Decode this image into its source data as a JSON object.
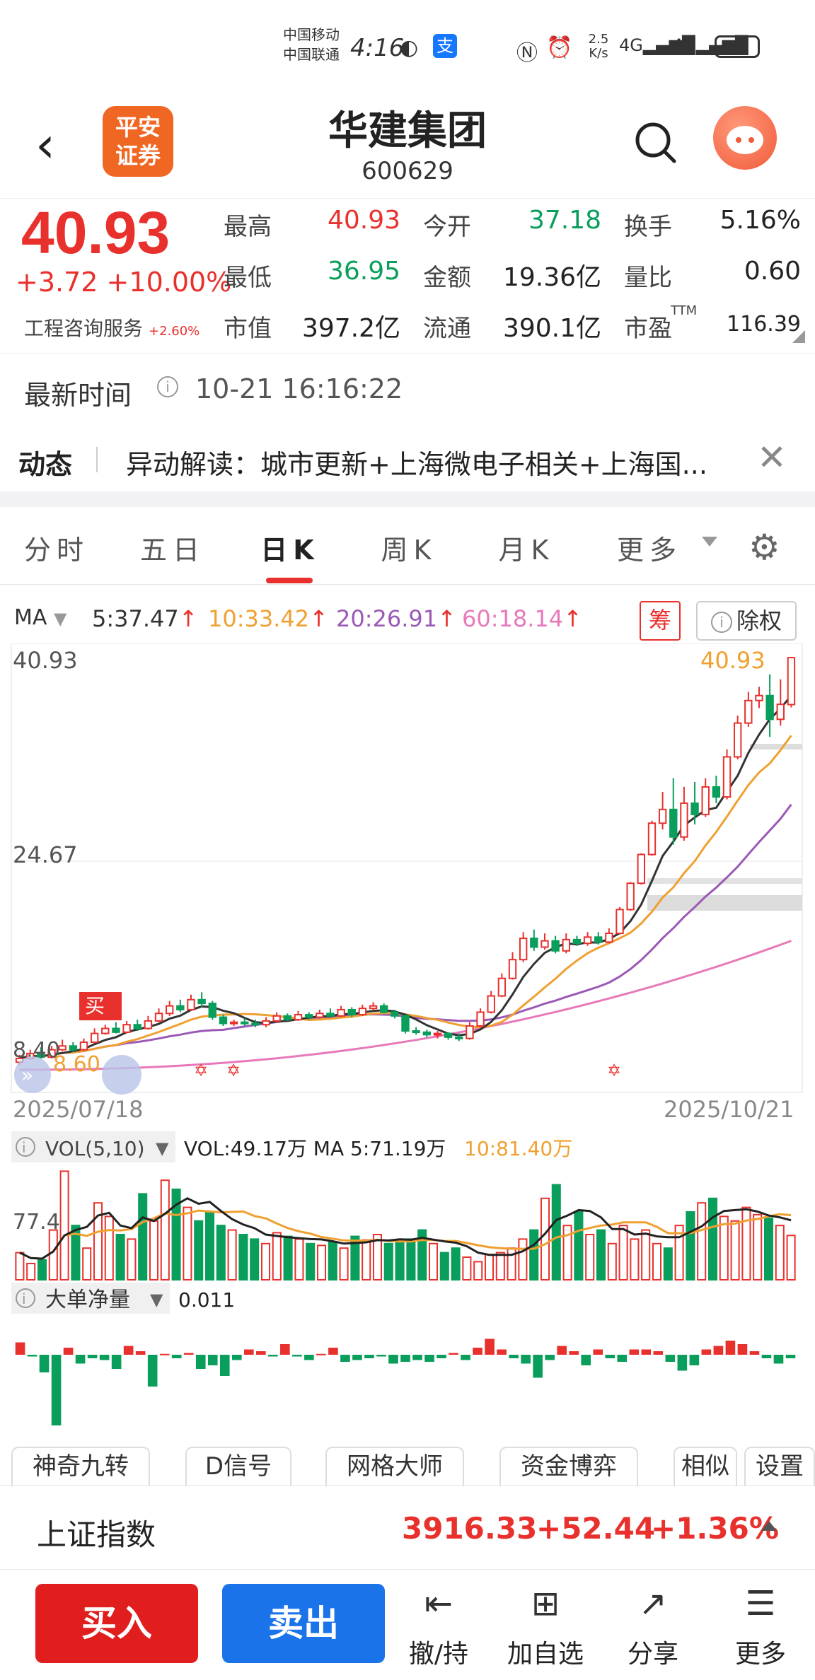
{
  "status_bar": {
    "carrier1": "中国移动",
    "carrier2": "中国联通",
    "time": "4:16",
    "net_speed": "2.5 K/s",
    "battery": "46"
  },
  "header": {
    "logo_line1": "平安",
    "logo_line2": "证券",
    "name": "华建集团",
    "code": "600629"
  },
  "quote": {
    "price": "40.93",
    "change": "+3.72",
    "change_pct": "+10.00%",
    "industry": "工程咨询服务",
    "industry_pct": "+2.60%",
    "high_label": "最高",
    "high": "40.93",
    "open_label": "今开",
    "open": "37.18",
    "turnover_label": "换手",
    "turnover": "5.16%",
    "low_label": "最低",
    "low": "36.95",
    "amount_label": "金额",
    "amount": "19.36亿",
    "vol_ratio_label": "量比",
    "vol_ratio": "0.60",
    "mktcap_label": "市值",
    "mktcap": "397.2亿",
    "float_label": "流通",
    "float": "390.1亿",
    "pe_label": "市盈",
    "pe_sup": "TTM",
    "pe": "116.39"
  },
  "latest": {
    "label": "最新时间",
    "time": "10-21 16:16:22"
  },
  "news": {
    "tag": "动态",
    "text": "异动解读：城市更新+上海微电子相关+上海国..."
  },
  "tabs": [
    "分时",
    "五日",
    "日K",
    "周K",
    "月K",
    "更多"
  ],
  "ma": {
    "label": "MA",
    "ma5": "5:37.47",
    "ma10": "10:33.42",
    "ma20": "20:26.91",
    "ma60": "60:18.14",
    "chou": "筹",
    "chuquan": "除权",
    "colors": {
      "ma5": "#333333",
      "ma10": "#f0a030",
      "ma20": "#9b59b6",
      "ma60": "#e879b9"
    }
  },
  "chart_data": [
    {
      "type": "candlestick",
      "y_labels": [
        "40.93",
        "24.67"
      ],
      "high_annotation": "40.93",
      "low_annotation": "8.60",
      "left_price_label": "8.40",
      "buy_marker": "买",
      "start_date": "2025/07/18",
      "end_date": "2025/10/21",
      "candles": [
        {
          "o": 8.6,
          "c": 8.9,
          "h": 9.2,
          "l": 8.4
        },
        {
          "o": 8.9,
          "c": 9.3,
          "h": 9.6,
          "l": 8.8
        },
        {
          "o": 9.3,
          "c": 9.0,
          "h": 9.8,
          "l": 8.9
        },
        {
          "o": 9.0,
          "c": 9.6,
          "h": 9.9,
          "l": 8.9
        },
        {
          "o": 9.6,
          "c": 9.9,
          "h": 10.4,
          "l": 9.5
        },
        {
          "o": 9.9,
          "c": 9.6,
          "h": 10.2,
          "l": 9.4
        },
        {
          "o": 9.6,
          "c": 10.2,
          "h": 10.5,
          "l": 9.5
        },
        {
          "o": 10.2,
          "c": 10.9,
          "h": 11.3,
          "l": 10.1
        },
        {
          "o": 10.9,
          "c": 11.3,
          "h": 11.6,
          "l": 10.8
        },
        {
          "o": 11.3,
          "c": 11.0,
          "h": 11.8,
          "l": 10.9
        },
        {
          "o": 11.0,
          "c": 11.6,
          "h": 11.9,
          "l": 10.9
        },
        {
          "o": 11.6,
          "c": 11.3,
          "h": 12.0,
          "l": 11.1
        },
        {
          "o": 11.3,
          "c": 11.9,
          "h": 12.3,
          "l": 11.2
        },
        {
          "o": 11.9,
          "c": 12.5,
          "h": 12.9,
          "l": 11.8
        },
        {
          "o": 12.5,
          "c": 13.1,
          "h": 13.5,
          "l": 12.3
        },
        {
          "o": 13.1,
          "c": 12.8,
          "h": 13.6,
          "l": 12.6
        },
        {
          "o": 12.8,
          "c": 13.6,
          "h": 14.0,
          "l": 12.7
        },
        {
          "o": 13.6,
          "c": 13.3,
          "h": 14.2,
          "l": 13.0
        },
        {
          "o": 13.3,
          "c": 12.2,
          "h": 13.5,
          "l": 12.0
        },
        {
          "o": 12.2,
          "c": 11.7,
          "h": 12.4,
          "l": 11.5
        },
        {
          "o": 11.7,
          "c": 11.8,
          "h": 12.0,
          "l": 11.5
        },
        {
          "o": 11.8,
          "c": 11.7,
          "h": 12.1,
          "l": 11.5
        },
        {
          "o": 11.7,
          "c": 11.6,
          "h": 12.0,
          "l": 11.4
        },
        {
          "o": 11.6,
          "c": 11.9,
          "h": 12.2,
          "l": 11.4
        },
        {
          "o": 11.9,
          "c": 12.3,
          "h": 12.6,
          "l": 11.8
        },
        {
          "o": 12.3,
          "c": 12.0,
          "h": 12.5,
          "l": 11.9
        },
        {
          "o": 12.0,
          "c": 12.4,
          "h": 12.7,
          "l": 11.9
        },
        {
          "o": 12.4,
          "c": 12.2,
          "h": 12.6,
          "l": 12.0
        },
        {
          "o": 12.2,
          "c": 12.5,
          "h": 12.8,
          "l": 12.1
        },
        {
          "o": 12.5,
          "c": 12.3,
          "h": 12.9,
          "l": 12.2
        },
        {
          "o": 12.3,
          "c": 12.8,
          "h": 13.1,
          "l": 12.2
        },
        {
          "o": 12.8,
          "c": 12.4,
          "h": 13.0,
          "l": 12.2
        },
        {
          "o": 12.4,
          "c": 12.9,
          "h": 13.2,
          "l": 12.3
        },
        {
          "o": 12.9,
          "c": 13.1,
          "h": 13.4,
          "l": 12.8
        },
        {
          "o": 13.1,
          "c": 12.6,
          "h": 13.3,
          "l": 12.5
        },
        {
          "o": 12.6,
          "c": 12.3,
          "h": 12.8,
          "l": 12.1
        },
        {
          "o": 12.3,
          "c": 11.1,
          "h": 12.4,
          "l": 10.9
        },
        {
          "o": 11.1,
          "c": 11.0,
          "h": 11.4,
          "l": 10.8
        },
        {
          "o": 11.0,
          "c": 10.8,
          "h": 11.2,
          "l": 10.6
        },
        {
          "o": 10.8,
          "c": 10.9,
          "h": 11.1,
          "l": 10.5
        },
        {
          "o": 10.9,
          "c": 10.6,
          "h": 11.0,
          "l": 10.4
        },
        {
          "o": 10.6,
          "c": 10.5,
          "h": 10.9,
          "l": 10.3
        },
        {
          "o": 10.5,
          "c": 11.5,
          "h": 11.8,
          "l": 10.4
        },
        {
          "o": 11.5,
          "c": 12.6,
          "h": 12.9,
          "l": 11.4
        },
        {
          "o": 12.6,
          "c": 13.9,
          "h": 14.3,
          "l": 12.5
        },
        {
          "o": 13.9,
          "c": 15.3,
          "h": 15.7,
          "l": 13.8
        },
        {
          "o": 15.3,
          "c": 16.8,
          "h": 17.4,
          "l": 15.2
        },
        {
          "o": 16.8,
          "c": 18.5,
          "h": 19.0,
          "l": 16.6
        },
        {
          "o": 18.5,
          "c": 17.8,
          "h": 19.2,
          "l": 17.5
        },
        {
          "o": 17.8,
          "c": 18.3,
          "h": 18.9,
          "l": 17.6
        },
        {
          "o": 18.3,
          "c": 17.5,
          "h": 18.7,
          "l": 17.3
        },
        {
          "o": 17.5,
          "c": 18.4,
          "h": 18.9,
          "l": 17.3
        },
        {
          "o": 18.4,
          "c": 18.1,
          "h": 18.7,
          "l": 17.9
        },
        {
          "o": 18.1,
          "c": 18.6,
          "h": 19.0,
          "l": 17.9
        },
        {
          "o": 18.6,
          "c": 18.2,
          "h": 19.0,
          "l": 18.0
        },
        {
          "o": 18.2,
          "c": 18.9,
          "h": 19.3,
          "l": 18.1
        },
        {
          "o": 18.9,
          "c": 20.8,
          "h": 21.0,
          "l": 18.8
        },
        {
          "o": 20.8,
          "c": 22.9,
          "h": 23.0,
          "l": 20.7
        },
        {
          "o": 22.9,
          "c": 25.2,
          "h": 25.3,
          "l": 22.8
        },
        {
          "o": 25.2,
          "c": 27.7,
          "h": 27.9,
          "l": 25.1
        },
        {
          "o": 27.7,
          "c": 28.8,
          "h": 30.2,
          "l": 27.2
        },
        {
          "o": 28.8,
          "c": 26.6,
          "h": 31.3,
          "l": 26.0
        },
        {
          "o": 26.6,
          "c": 29.3,
          "h": 30.6,
          "l": 26.3
        },
        {
          "o": 29.3,
          "c": 28.4,
          "h": 31.0,
          "l": 27.6
        },
        {
          "o": 28.4,
          "c": 30.6,
          "h": 31.3,
          "l": 28.2
        },
        {
          "o": 30.6,
          "c": 29.8,
          "h": 31.5,
          "l": 29.3
        },
        {
          "o": 29.8,
          "c": 33.0,
          "h": 33.6,
          "l": 29.6
        },
        {
          "o": 33.0,
          "c": 35.7,
          "h": 36.3,
          "l": 32.8
        },
        {
          "o": 35.7,
          "c": 37.5,
          "h": 38.2,
          "l": 35.4
        },
        {
          "o": 37.5,
          "c": 37.9,
          "h": 38.6,
          "l": 36.9
        },
        {
          "o": 37.9,
          "c": 36.0,
          "h": 39.6,
          "l": 34.6
        },
        {
          "o": 36.0,
          "c": 37.2,
          "h": 39.2,
          "l": 35.5
        },
        {
          "o": 37.18,
          "c": 40.93,
          "h": 40.93,
          "l": 36.95
        }
      ]
    },
    {
      "type": "bar",
      "title": "VOL(5,10)",
      "summary": "VOL:49.17万 MA 5:71.19万",
      "ma10": "10:81.40万",
      "y_label": "77.4",
      "values": [
        30,
        18,
        22,
        55,
        120,
        60,
        35,
        85,
        70,
        50,
        45,
        95,
        65,
        110,
        100,
        80,
        65,
        75,
        60,
        55,
        50,
        45,
        40,
        52,
        48,
        45,
        40,
        38,
        42,
        35,
        48,
        44,
        50,
        40,
        42,
        45,
        55,
        40,
        30,
        35,
        25,
        20,
        28,
        30,
        35,
        45,
        55,
        90,
        105,
        60,
        75,
        50,
        55,
        40,
        60,
        45,
        55,
        40,
        35,
        60,
        75,
        85,
        90,
        70,
        65,
        80,
        72,
        68,
        60,
        49
      ]
    },
    {
      "type": "bar",
      "title": "大单净量",
      "value": "0.011",
      "values": [
        0.7,
        -0.1,
        -1.0,
        -4.0,
        0.4,
        -0.5,
        -0.2,
        -0.3,
        -0.8,
        0.5,
        0.2,
        -1.8,
        0.05,
        -0.2,
        0.1,
        -0.8,
        -0.6,
        -1.2,
        -0.3,
        0.3,
        0.2,
        -0.1,
        0.6,
        -0.1,
        -0.3,
        0.05,
        0.4,
        -0.4,
        -0.3,
        -0.2,
        -0.1,
        -0.5,
        -0.4,
        -0.3,
        -0.4,
        -0.2,
        0.1,
        -0.3,
        0.4,
        0.9,
        0.3,
        -0.2,
        -0.5,
        -1.3,
        -0.3,
        0.5,
        0.2,
        -0.6,
        0.3,
        -0.2,
        -0.4,
        0.3,
        0.3,
        0.2,
        -0.4,
        -0.9,
        -0.6,
        0.3,
        0.5,
        0.8,
        0.6,
        0.2,
        -0.2,
        -0.5,
        -0.2
      ]
    }
  ],
  "indicators": [
    "神奇九转",
    "D信号",
    "网格大师",
    "资金博弈",
    "相似",
    "设置"
  ],
  "index_bar": {
    "name": "上证指数",
    "value": "3916.33",
    "change": "+52.44",
    "change_pct": "+1.36%"
  },
  "bottom": {
    "buy": "买入",
    "sell": "卖出",
    "actions": [
      {
        "icon": "undo-icon",
        "label": "撤/持"
      },
      {
        "icon": "plus-square-icon",
        "label": "加自选"
      },
      {
        "icon": "share-icon",
        "label": "分享"
      },
      {
        "icon": "menu-icon",
        "label": "更多"
      }
    ]
  }
}
